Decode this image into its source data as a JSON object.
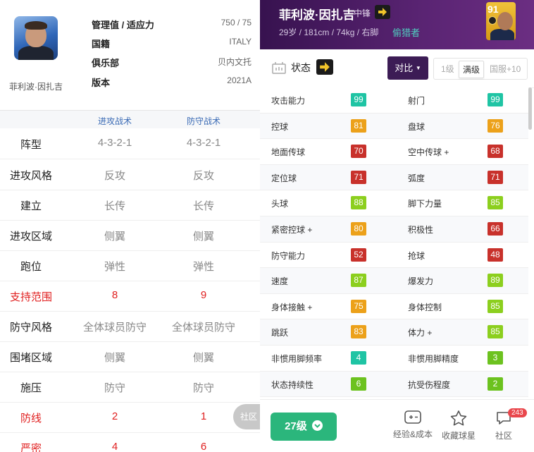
{
  "manager": {
    "name": "菲利波·因扎吉",
    "info": [
      {
        "label": "管理值 / 适应力",
        "value": "750 / 75"
      },
      {
        "label": "国籍",
        "value": "ITALY"
      },
      {
        "label": "俱乐部",
        "value": "贝内文托"
      },
      {
        "label": "版本",
        "value": "2021A"
      }
    ],
    "tactic_headers": [
      "进攻战术",
      "防守战术"
    ],
    "tactics": [
      {
        "label": "阵型",
        "attack": "4-3-2-1",
        "defense": "4-3-2-1"
      },
      {
        "label": "进攻风格",
        "attack": "反攻",
        "defense": "反攻"
      },
      {
        "label": "建立",
        "attack": "长传",
        "defense": "长传"
      },
      {
        "label": "进攻区域",
        "attack": "侧翼",
        "defense": "侧翼"
      },
      {
        "label": "跑位",
        "attack": "弹性",
        "defense": "弹性"
      },
      {
        "label": "支持范围",
        "attack": "8",
        "defense": "9"
      },
      {
        "label": "防守风格",
        "attack": "全体球员防守",
        "defense": "全体球员防守"
      },
      {
        "label": "围堵区域",
        "attack": "侧翼",
        "defense": "侧翼"
      },
      {
        "label": "施压",
        "attack": "防守",
        "defense": "防守"
      },
      {
        "label": "防线",
        "attack": "2",
        "defense": "1"
      },
      {
        "label": "严密",
        "attack": "4",
        "defense": "6"
      }
    ],
    "community_label": "社区"
  },
  "player": {
    "name": "菲利波·因扎吉",
    "position": "中锋",
    "details": "29岁 / 181cm / 74kg / 右脚",
    "style": "偷猎者",
    "rating": "91",
    "status_label": "状态",
    "compare_label": "对比",
    "level_options": [
      "1级",
      "满级",
      "国服+10"
    ],
    "selected_level": "满级",
    "stats": [
      [
        {
          "name": "攻击能力",
          "value": "99",
          "color": "#1fc4a4"
        },
        {
          "name": "射门",
          "value": "99",
          "color": "#1fc4a4"
        }
      ],
      [
        {
          "name": "控球",
          "value": "81",
          "color": "#eca11a"
        },
        {
          "name": "盘球",
          "value": "76",
          "color": "#eca11a"
        }
      ],
      [
        {
          "name": "地面传球",
          "value": "70",
          "color": "#c8312b"
        },
        {
          "name": "空中传球 +",
          "value": "68",
          "color": "#c8312b"
        }
      ],
      [
        {
          "name": "定位球",
          "value": "71",
          "color": "#c8312b"
        },
        {
          "name": "弧度",
          "value": "71",
          "color": "#c8312b"
        }
      ],
      [
        {
          "name": "头球",
          "value": "88",
          "color": "#8ccf1e"
        },
        {
          "name": "脚下力量",
          "value": "85",
          "color": "#8ccf1e"
        }
      ],
      [
        {
          "name": "紧密控球 +",
          "value": "80",
          "color": "#eca11a"
        },
        {
          "name": "积极性",
          "value": "66",
          "color": "#c8312b"
        }
      ],
      [
        {
          "name": "防守能力",
          "value": "52",
          "color": "#c8312b"
        },
        {
          "name": "抢球",
          "value": "48",
          "color": "#c8312b"
        }
      ],
      [
        {
          "name": "速度",
          "value": "87",
          "color": "#8ccf1e"
        },
        {
          "name": "爆发力",
          "value": "89",
          "color": "#8ccf1e"
        }
      ],
      [
        {
          "name": "身体接触 +",
          "value": "75",
          "color": "#eca11a"
        },
        {
          "name": "身体控制",
          "value": "85",
          "color": "#8ccf1e"
        }
      ],
      [
        {
          "name": "跳跃",
          "value": "83",
          "color": "#eca11a"
        },
        {
          "name": "体力 +",
          "value": "85",
          "color": "#8ccf1e"
        }
      ],
      [
        {
          "name": "非惯用脚频率",
          "value": "4",
          "color": "#1fc4a4"
        },
        {
          "name": "非惯用脚精度",
          "value": "3",
          "color": "#6cc21f"
        }
      ],
      [
        {
          "name": "状态持续性",
          "value": "6",
          "color": "#6cc21f"
        },
        {
          "name": "抗受伤程度",
          "value": "2",
          "color": "#6cc21f"
        }
      ]
    ],
    "level_button": "27级",
    "bottom_nav": [
      {
        "label": "经验&成本",
        "icon": "plus-box-icon"
      },
      {
        "label": "收藏球星",
        "icon": "star-icon"
      },
      {
        "label": "社区",
        "icon": "chat-bubble-icon",
        "badge": "243"
      }
    ]
  }
}
